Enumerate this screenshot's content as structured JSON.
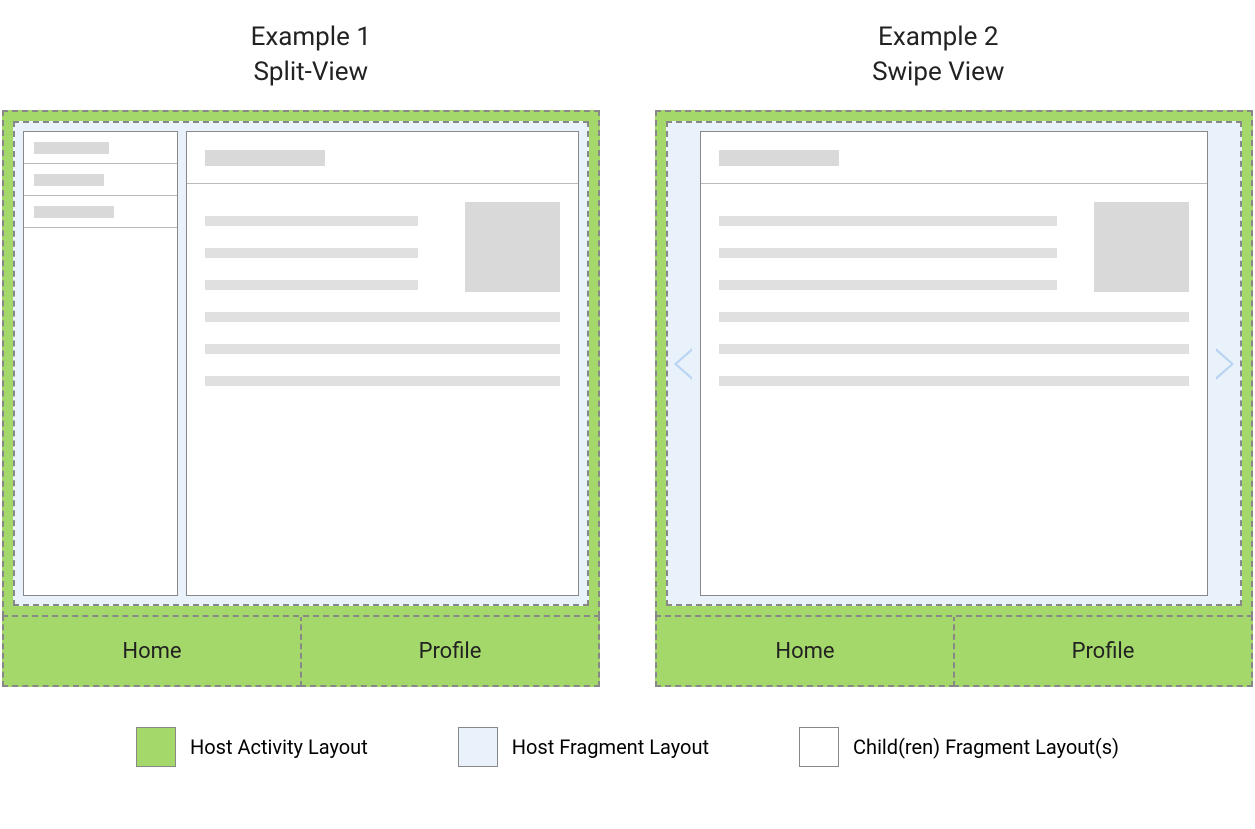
{
  "examples": {
    "ex1": {
      "label_line1": "Example 1",
      "label_line2": "Split-View"
    },
    "ex2": {
      "label_line1": "Example 2",
      "label_line2": "Swipe View"
    }
  },
  "nav": {
    "home": "Home",
    "profile": "Profile"
  },
  "legend": {
    "host_activity": "Host Activity Layout",
    "host_fragment": "Host Fragment Layout",
    "child_fragment": "Child(ren) Fragment Layout(s)"
  },
  "colors": {
    "host_activity": "#a5d86a",
    "host_fragment": "#e9f1fb",
    "child_fragment": "#ffffff",
    "placeholder": "#d9d9d9"
  }
}
